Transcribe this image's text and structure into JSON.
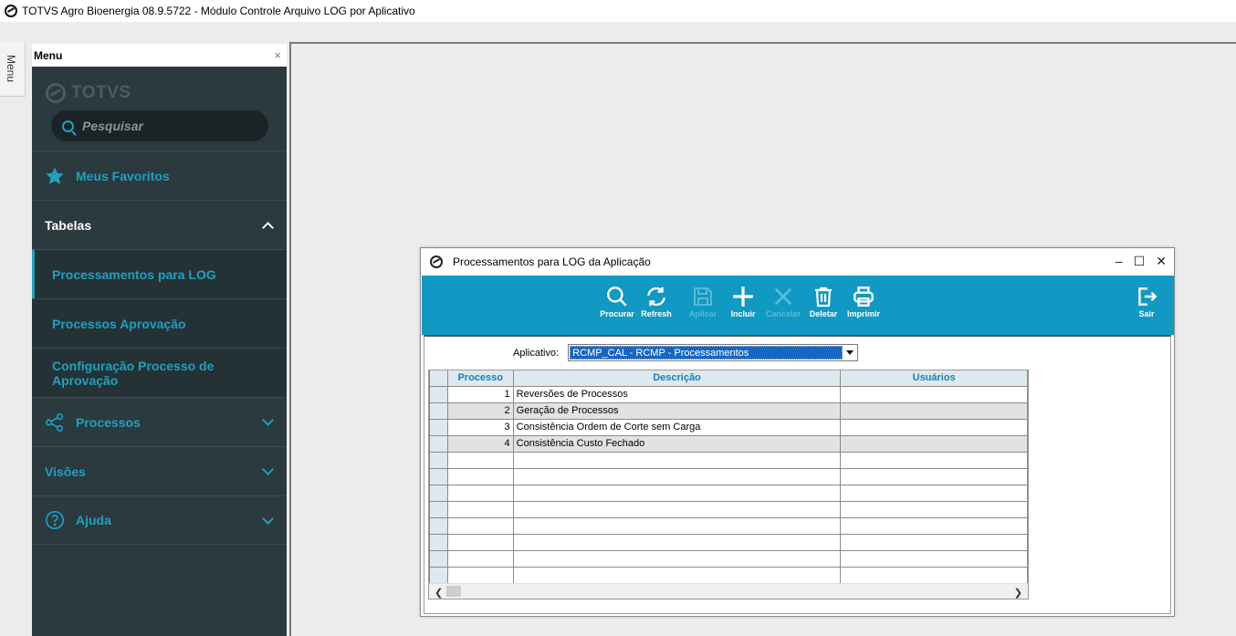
{
  "window": {
    "title": "TOTVS Agro Bioenergia 08.9.5722 - Módulo Controle Arquivo LOG por Aplicativo"
  },
  "menu_tab": {
    "label": "Menu"
  },
  "panel": {
    "title": "Menu",
    "close": "×",
    "brand": "TOTVS",
    "search_placeholder": "Pesquisar",
    "items": [
      {
        "label": "Meus Favoritos",
        "icon": "star-icon"
      },
      {
        "label": "Tabelas",
        "expanded": true
      },
      {
        "label": "Processamentos para LOG",
        "active": true
      },
      {
        "label": "Processos Aprovação"
      },
      {
        "label": "Configuração Processo de Aprovação"
      },
      {
        "label": "Processos",
        "icon": "share-icon"
      },
      {
        "label": "Visões"
      },
      {
        "label": "Ajuda",
        "icon": "help-icon"
      }
    ]
  },
  "dialog": {
    "title": "Processamentos para LOG da Aplicação",
    "controls": {
      "minimize": "–",
      "maximize": "☐",
      "close": "✕"
    },
    "toolbar": {
      "procurar": "Procurar",
      "refresh": "Refresh",
      "aplicar": "Aplicar",
      "incluir": "Incluir",
      "cancelar": "Cancelar",
      "deletar": "Deletar",
      "imprimir": "Imprimir",
      "sair": "Sair"
    },
    "aplicativo_label": "Aplicativo:",
    "aplicativo_value": "RCMP_CAL - RCMP - Processamentos",
    "grid": {
      "columns": [
        "Processo",
        "Descrição",
        "Usuários"
      ],
      "rows": [
        {
          "processo": "1",
          "descricao": "Reversões de Processos",
          "usuarios": ""
        },
        {
          "processo": "2",
          "descricao": "Geração de Processos",
          "usuarios": ""
        },
        {
          "processo": "3",
          "descricao": "Consistência Ordem de Corte sem Carga",
          "usuarios": ""
        },
        {
          "processo": "4",
          "descricao": "Consistência Custo Fechado",
          "usuarios": ""
        }
      ]
    }
  }
}
